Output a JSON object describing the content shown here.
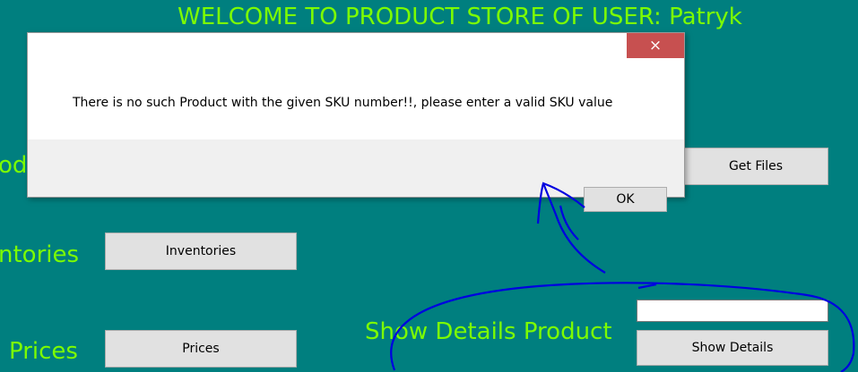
{
  "header": {
    "welcome": "WELCOME TO PRODUCT STORE OF USER:  Patryk"
  },
  "left_labels": {
    "products_partial": "od",
    "inventories_partial": "ntories",
    "prices": "Prices"
  },
  "buttons": {
    "get_files": "Get Files",
    "inventories": "Inventories",
    "prices": "Prices",
    "show_details": "Show Details"
  },
  "show_details": {
    "label": "Show Details Product",
    "sku_value": ""
  },
  "dialog": {
    "message": "There is no such Product with the given SKU number!!, please enter a valid SKU value",
    "ok": "OK",
    "close_glyph": "×"
  },
  "colors": {
    "background": "#007f7f",
    "label": "#7cfc00",
    "close": "#c75050",
    "annotation": "#0000e0"
  }
}
